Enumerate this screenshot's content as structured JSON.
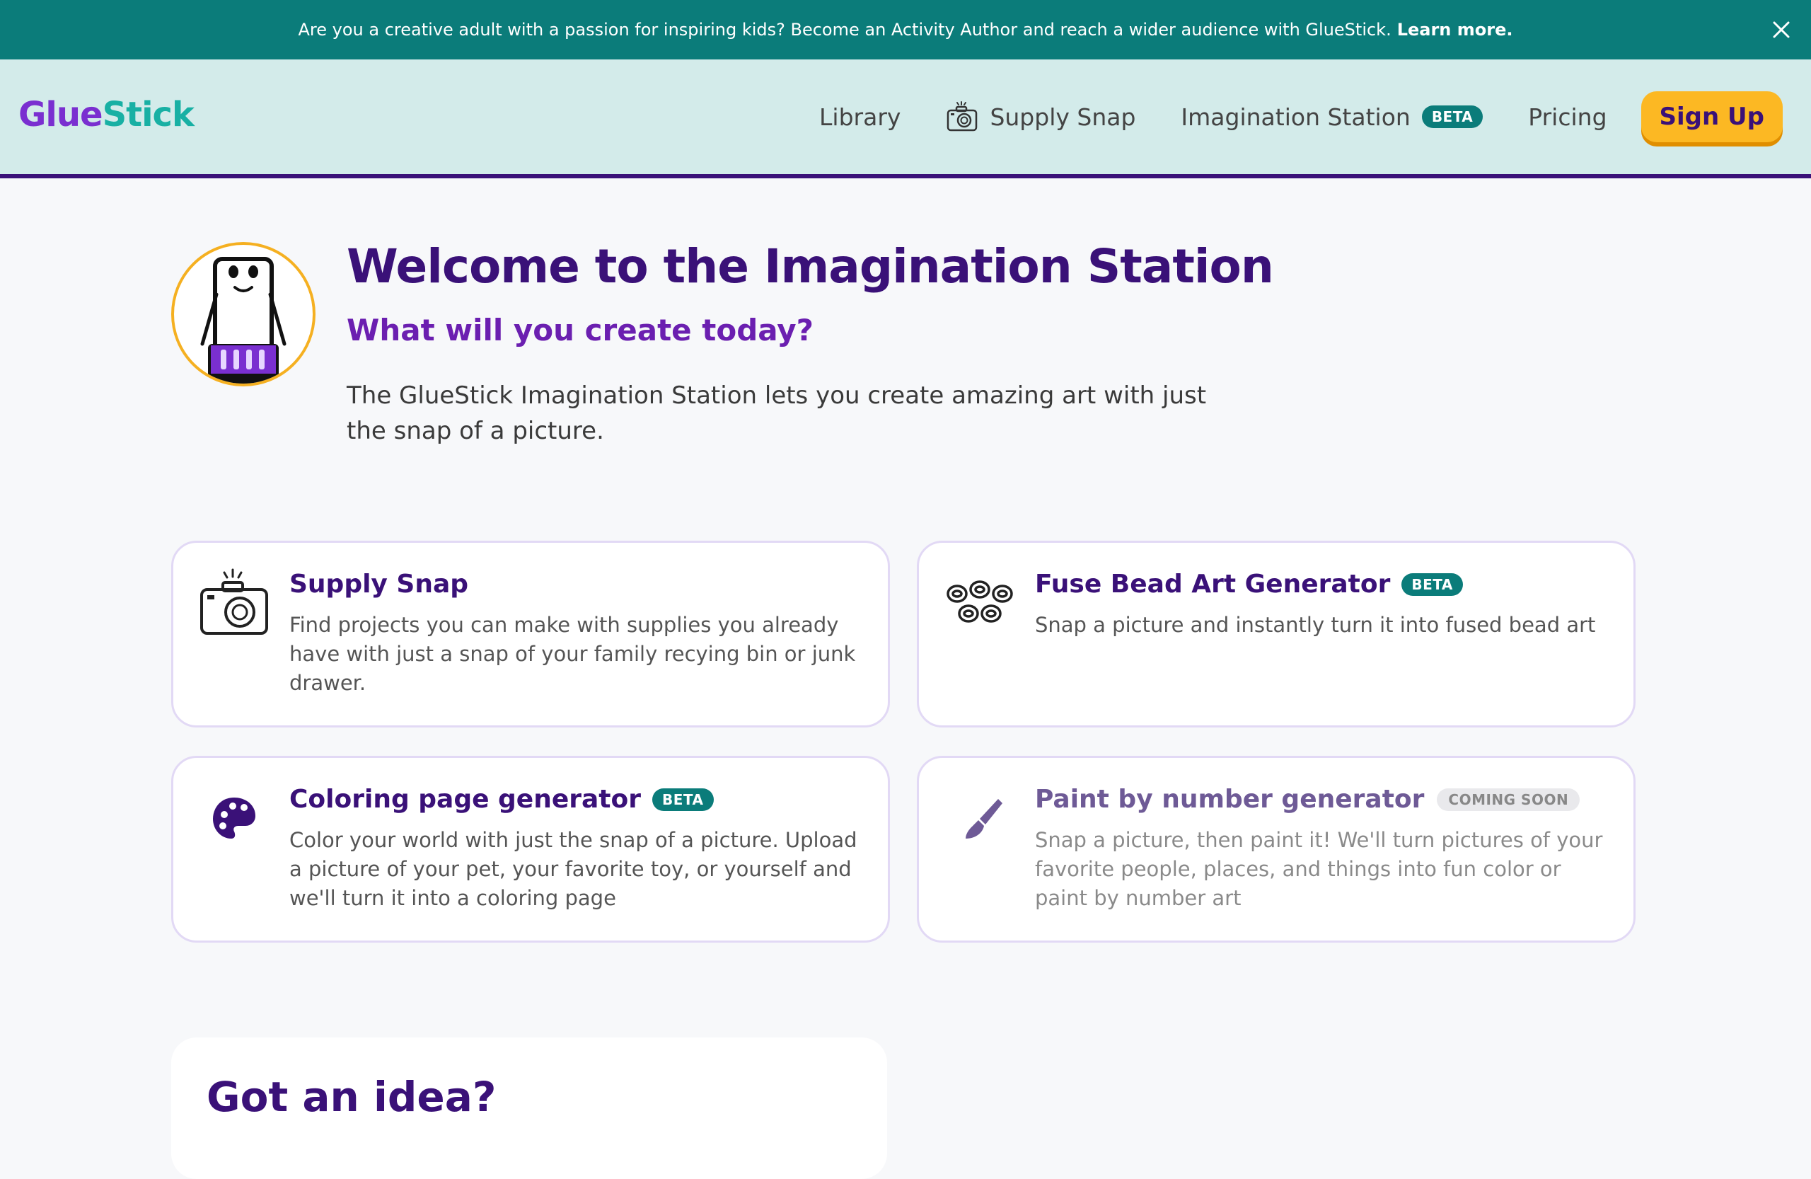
{
  "banner": {
    "text": "Are you a creative adult with a passion for inspiring kids? Become an Activity Author and reach a wider audience with GlueStick.",
    "link": "Learn more."
  },
  "header": {
    "logo_part1": "Glue",
    "logo_part2": "Stick",
    "nav": {
      "library": "Library",
      "supply_snap": "Supply Snap",
      "imagination_station": "Imagination Station",
      "beta": "BETA",
      "pricing": "Pricing",
      "signup": "Sign Up"
    }
  },
  "hero": {
    "title": "Welcome to the Imagination Station",
    "subtitle": "What will you create today?",
    "description": "The GlueStick Imagination Station lets you create amazing art with just the snap of a picture."
  },
  "cards": {
    "supply_snap": {
      "title": "Supply Snap",
      "description": "Find projects you can make with supplies you already have with just a snap of your family recying bin or junk drawer."
    },
    "fuse_bead": {
      "title": "Fuse Bead Art Generator",
      "badge": "BETA",
      "description": "Snap a picture and instantly turn it into fused bead art"
    },
    "coloring": {
      "title": "Coloring page generator",
      "badge": "BETA",
      "description": "Color your world with just the snap of a picture. Upload a picture of your pet, your favorite toy, or yourself and we'll turn it into a coloring page"
    },
    "paint_by_number": {
      "title": "Paint by number generator",
      "badge": "COMING SOON",
      "description": "Snap a picture, then paint it! We'll turn pictures of your favorite people, places, and things into fun color or paint by number art"
    }
  },
  "idea": {
    "title": "Got an idea?"
  },
  "colors": {
    "banner_bg": "#0b7c7a",
    "header_bg": "#d3ebea",
    "primary_purple": "#3a1178",
    "accent_purple": "#6b1fb0",
    "signup_yellow": "#fcb823"
  },
  "icons": {
    "close": "close-icon",
    "camera": "camera-icon",
    "beads": "beads-icon",
    "palette": "palette-icon",
    "brush": "brush-icon",
    "mascot": "gluestick-mascot-icon"
  }
}
